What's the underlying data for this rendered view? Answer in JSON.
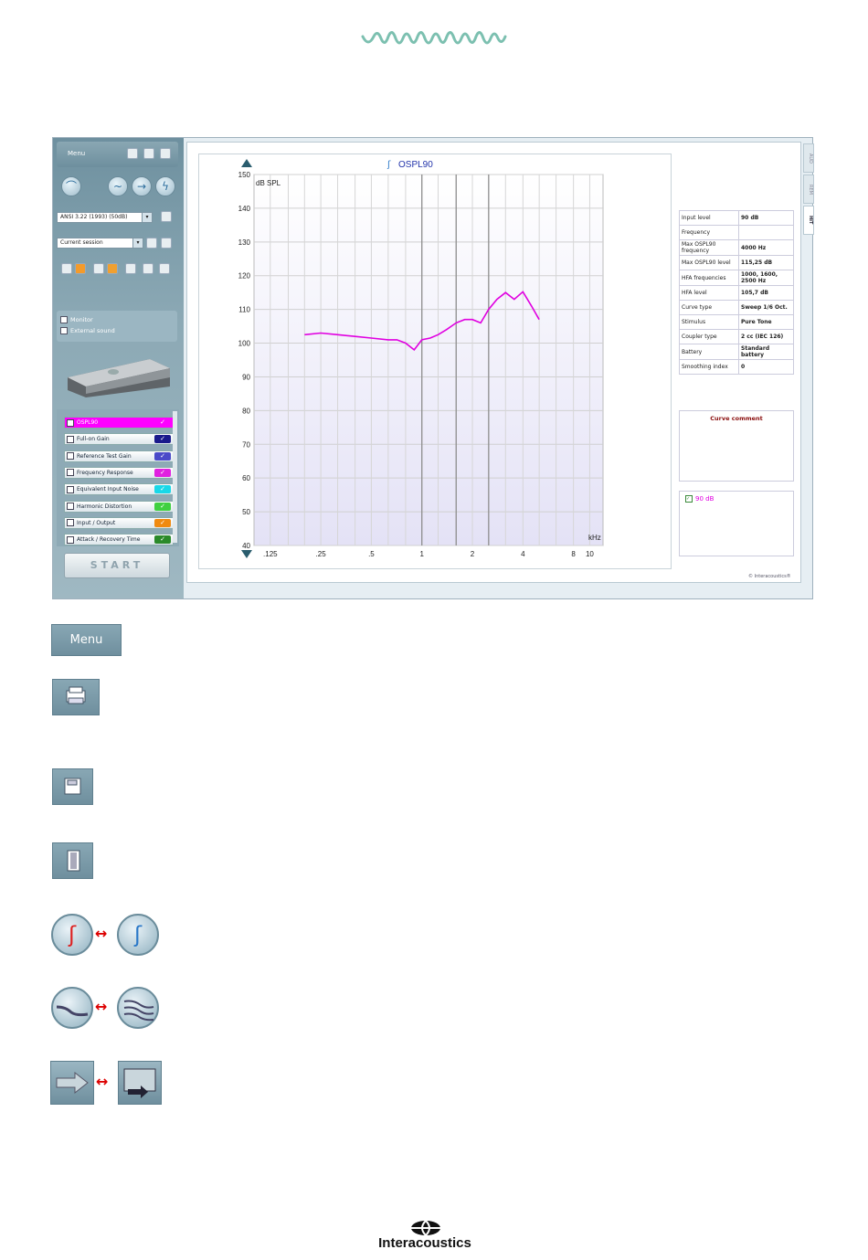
{
  "screen": {
    "menu_label": "Menu",
    "protocol_select": "ANSI 3.22 (1993) (50dB)",
    "session_select": "Current session",
    "monitor_label": "Monitor",
    "external_sound_label": "External sound",
    "measurements": [
      {
        "label": "OSPL90",
        "color": "#ff00ff",
        "active": true
      },
      {
        "label": "Full-on Gain",
        "color": "#1a1a8c",
        "active": false
      },
      {
        "label": "Reference Test Gain",
        "color": "#4a4ac8",
        "active": false
      },
      {
        "label": "Frequency Response",
        "color": "#e020e0",
        "active": false
      },
      {
        "label": "Equivalent Input Noise",
        "color": "#18d8e8",
        "active": false
      },
      {
        "label": "Harmonic Distortion",
        "color": "#40d040",
        "active": false
      },
      {
        "label": "Input / Output",
        "color": "#f08a10",
        "active": false
      },
      {
        "label": "Attack / Recovery Time",
        "color": "#2a8a2a",
        "active": false
      }
    ],
    "start_label": "START",
    "tabs": [
      "AUD",
      "REM",
      "HIT"
    ],
    "info_table": [
      {
        "k": "Input level",
        "v": "90 dB"
      },
      {
        "k": "Frequency",
        "v": ""
      },
      {
        "k": "Max OSPL90 frequency",
        "v": "4000 Hz"
      },
      {
        "k": "Max OSPL90 level",
        "v": "115,25 dB"
      },
      {
        "k": "HFA frequencies",
        "v": "1000, 1600, 2500 Hz"
      },
      {
        "k": "HFA level",
        "v": "105,7 dB"
      },
      {
        "k": "Curve type",
        "v": "Sweep 1/6 Oct."
      },
      {
        "k": "Stimulus",
        "v": "Pure Tone"
      },
      {
        "k": "Coupler type",
        "v": "2 cc (IEC 126)"
      },
      {
        "k": "Battery",
        "v": "Standard battery"
      },
      {
        "k": "Smoothing index",
        "v": "0"
      }
    ],
    "curve_comment_label": "Curve comment",
    "legend_entry": "90 dB",
    "copyright": "© Interacoustics®"
  },
  "chart_data": {
    "type": "line",
    "title": "OSPL90",
    "ylabel": "dB SPL",
    "xlabel": "kHz",
    "ylim": [
      40,
      150
    ],
    "yticks": [
      40,
      50,
      60,
      70,
      80,
      90,
      100,
      110,
      120,
      130,
      140,
      150
    ],
    "xticks_labels": [
      ".125",
      ".25",
      ".5",
      "1",
      "2",
      "4",
      "8",
      "10"
    ],
    "xticks_values": [
      0.125,
      0.25,
      0.5,
      1,
      2,
      4,
      8,
      10
    ],
    "xscale": "log",
    "xlim": [
      0.1,
      12
    ],
    "series": [
      {
        "name": "90 dB",
        "color": "#e000e0",
        "x": [
          0.2,
          0.25,
          0.315,
          0.4,
          0.5,
          0.63,
          0.71,
          0.8,
          0.9,
          1.0,
          1.12,
          1.25,
          1.4,
          1.6,
          1.8,
          2.0,
          2.24,
          2.5,
          2.8,
          3.15,
          3.55,
          4.0,
          4.5,
          5.0
        ],
        "y": [
          102.5,
          103,
          102.5,
          102,
          101.5,
          101,
          101,
          100,
          98,
          101,
          101.5,
          102.5,
          104,
          106,
          107,
          107,
          106,
          110,
          113,
          115,
          113,
          115.25,
          111,
          107
        ]
      }
    ]
  },
  "legend_icons": {
    "menu_label": "Menu"
  },
  "footer": {
    "brand": "Interacoustics"
  }
}
